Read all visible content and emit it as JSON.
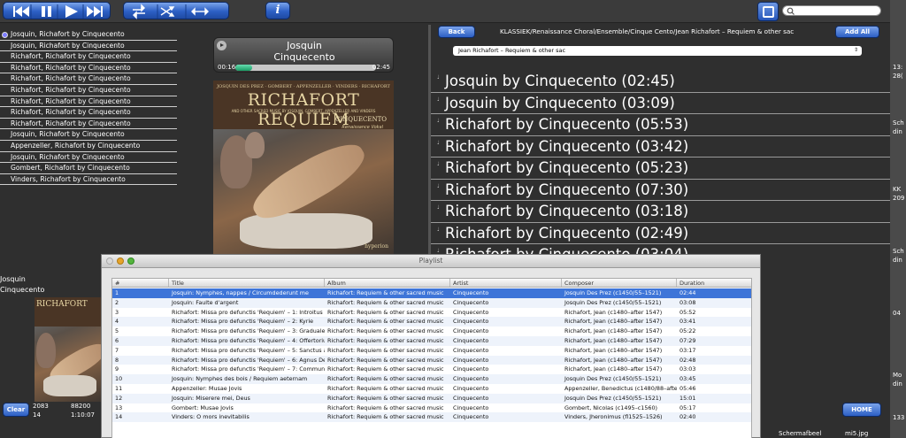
{
  "toolbar": {
    "info_label": "i",
    "search_placeholder": ""
  },
  "track_list": [
    "Josquin, Richafort by Cinquecento",
    "Josquin, Richafort by Cinquecento",
    "Richafort, Richafort by Cinquecento",
    "Richafort, Richafort by Cinquecento",
    "Richafort, Richafort by Cinquecento",
    "Richafort, Richafort by Cinquecento",
    "Richafort, Richafort by Cinquecento",
    "Richafort, Richafort by Cinquecento",
    "Richafort, Richafort by Cinquecento",
    "Josquin, Richafort by Cinquecento",
    "Appenzeller, Richafort by Cinquecento",
    "Josquin, Richafort by Cinquecento",
    "Gombert, Richafort by Cinquecento",
    "Vinders, Richafort by Cinquecento"
  ],
  "now_playing": {
    "title_line1": "Josquin",
    "title_line2": "Cinquecento",
    "elapsed": "00:16",
    "remaining": "02:45",
    "progress": 0.12
  },
  "album_art": {
    "heading_top": "JOSQUIN DES PREZ · GOMBERT · APPENZELLER · VINDERS · RICHAFORT",
    "title": "RICHAFORT REQUIEM",
    "subheading": "AND OTHER SACRED MUSIC BY JOSQUIN, GOMBERT, APPENZELLER AND VINDERS",
    "ensemble": "CINQUECENTO",
    "conductor": "Renaissance Vokal",
    "label": "hyperion"
  },
  "small_panel": {
    "artist": "Josquin",
    "album": "Cinquecento",
    "art_title": "RICHAFORT"
  },
  "browser": {
    "back_label": "Back",
    "add_all_label": "Add All",
    "path": "KLASSIEK/Renaissance Choral/Ensemble/Cinque Cento/Jean Richafort – Requiem & other sac",
    "album_select": "Jean Richafort – Requiem & other sac",
    "items": [
      "Josquin by Cinquecento (02:45)",
      "Josquin by Cinquecento (03:09)",
      "Richafort by Cinquecento (05:53)",
      "Richafort by Cinquecento (03:42)",
      "Richafort by Cinquecento (05:23)",
      "Richafort by Cinquecento (07:30)",
      "Richafort by Cinquecento (03:18)",
      "Richafort by Cinquecento (02:49)",
      "Richafort by Cinquecento (03:04)"
    ]
  },
  "status": {
    "clear_label": "Clear",
    "tracks_count": "2083",
    "tracks_secondary": "88200",
    "playlist_count": "14",
    "playlist_duration": "1:10:07",
    "home_label": "HOME"
  },
  "playlist": {
    "window_title": "Playlist",
    "columns": [
      "#",
      "Title",
      "Album",
      "Artist",
      "Composer",
      "Duration"
    ],
    "rows": [
      [
        "1",
        "Josquin: Nymphes, nappes / Circumdederunt me",
        "Richafort: Requiem & other sacred music",
        "Cinquecento",
        "Josquin Des Prez (c1450/55–1521)",
        "02:44"
      ],
      [
        "2",
        "Josquin: Faulte d'argent",
        "Richafort: Requiem & other sacred music",
        "Cinquecento",
        "Josquin Des Prez (c1450/55–1521)",
        "03:08"
      ],
      [
        "3",
        "Richafort: Missa pro defunctis 'Requiem' – 1: Introitus",
        "Richafort: Requiem & other sacred music",
        "Cinquecento",
        "Richafort, Jean (c1480–after 1547)",
        "05:52"
      ],
      [
        "4",
        "Richafort: Missa pro defunctis 'Requiem' – 2: Kyrie",
        "Richafort: Requiem & other sacred music",
        "Cinquecento",
        "Richafort, Jean (c1480–after 1547)",
        "03:41"
      ],
      [
        "5",
        "Richafort: Missa pro defunctis 'Requiem' – 3: Graduale",
        "Richafort: Requiem & other sacred music",
        "Cinquecento",
        "Richafort, Jean (c1480–after 1547)",
        "05:22"
      ],
      [
        "6",
        "Richafort: Missa pro defunctis 'Requiem' – 4: Offertorium",
        "Richafort: Requiem & other sacred music",
        "Cinquecento",
        "Richafort, Jean (c1480–after 1547)",
        "07:29"
      ],
      [
        "7",
        "Richafort: Missa pro defunctis 'Requiem' – 5: Sanctus an...",
        "Richafort: Requiem & other sacred music",
        "Cinquecento",
        "Richafort, Jean (c1480–after 1547)",
        "03:17"
      ],
      [
        "8",
        "Richafort: Missa pro defunctis 'Requiem' – 6: Agnus Dei",
        "Richafort: Requiem & other sacred music",
        "Cinquecento",
        "Richafort, Jean (c1480–after 1547)",
        "02:48"
      ],
      [
        "9",
        "Richafort: Missa pro defunctis 'Requiem' – 7: Communio",
        "Richafort: Requiem & other sacred music",
        "Cinquecento",
        "Richafort, Jean (c1480–after 1547)",
        "03:03"
      ],
      [
        "10",
        "Josquin: Nymphes des bois / Requiem aeternam",
        "Richafort: Requiem & other sacred music",
        "Cinquecento",
        "Josquin Des Prez (c1450/55–1521)",
        "03:45"
      ],
      [
        "11",
        "Appenzeller: Musae Jovis",
        "Richafort: Requiem & other sacred music",
        "Cinquecento",
        "Appenzeller, Benedictus (c1480/88–after...",
        "05:46"
      ],
      [
        "12",
        "Josquin: Miserere mei, Deus",
        "Richafort: Requiem & other sacred music",
        "Cinquecento",
        "Josquin Des Prez (c1450/55–1521)",
        "15:01"
      ],
      [
        "13",
        "Gombert: Musae Jovis",
        "Richafort: Requiem & other sacred music",
        "Cinquecento",
        "Gombert, Nicolas (c1495–c1560)",
        "05:17"
      ],
      [
        "14",
        "Vinders: O mors inevitabilis",
        "Richafort: Requiem & other sacred music",
        "Cinquecento",
        "Vinders, Jheronimus (fl1525–1526)",
        "02:40"
      ]
    ]
  },
  "desktop": {
    "items": [
      "13:",
      "28(",
      "Sch",
      "din",
      "KK",
      "209",
      "Sch",
      "din",
      "04",
      "Mo",
      "din",
      "133"
    ],
    "bottom_files": [
      "Schermafbeel",
      "mi5.jpg"
    ]
  },
  "colors": {
    "accent": "#2c5fc4",
    "selection": "#3e75d8",
    "progress": "#1a9b63"
  },
  "icons": {
    "transport": [
      "previous-icon",
      "pause-icon",
      "play-icon",
      "next-icon"
    ],
    "modes": [
      "repeat-icon",
      "shuffle-icon",
      "expand-icon"
    ]
  }
}
